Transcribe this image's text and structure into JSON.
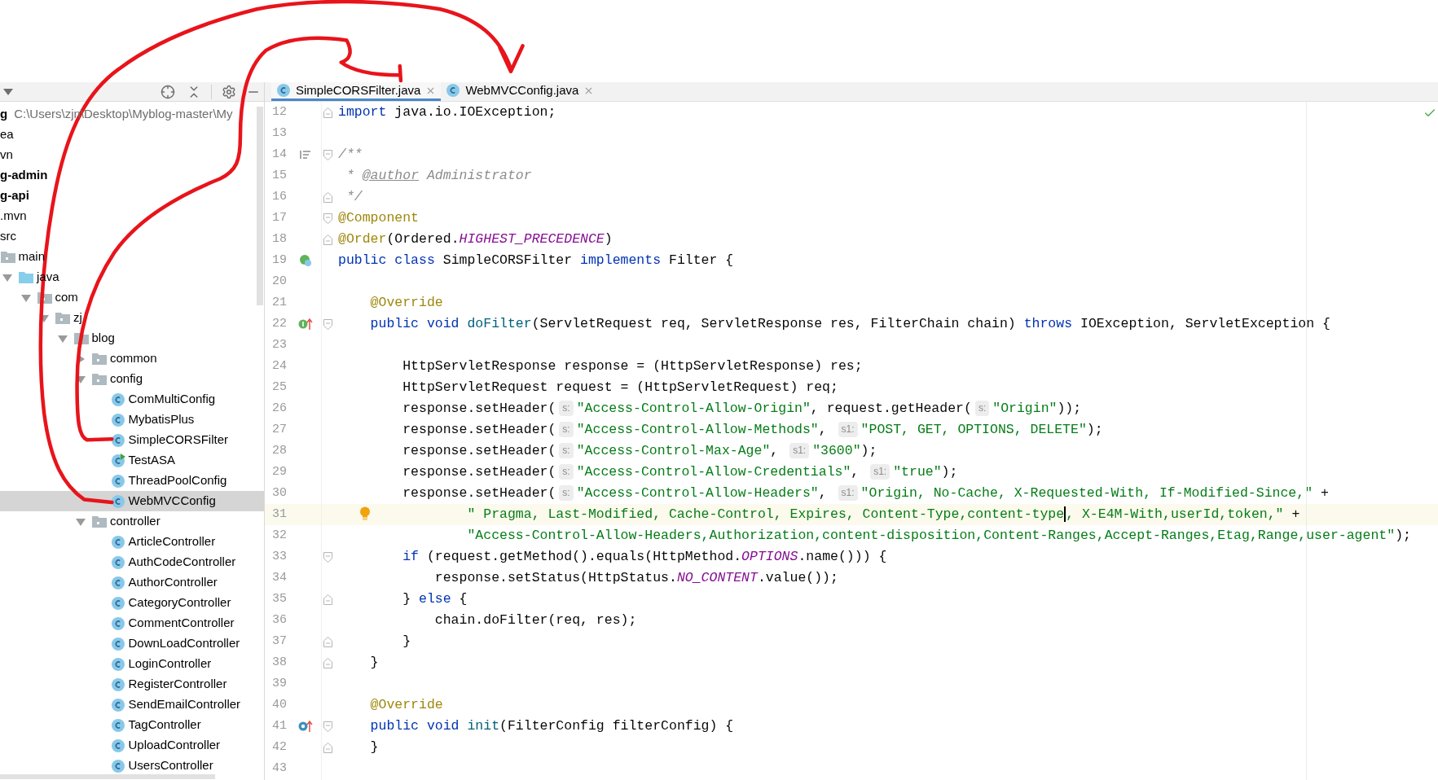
{
  "tree": {
    "items": [
      {
        "kind": "project",
        "name": "g",
        "path": "C:\\Users\\zjn\\Desktop\\Myblog-master\\My",
        "selected": false,
        "children": [
          {
            "name": "ea",
            "selected": false
          },
          {
            "name": "vn",
            "selected": false
          },
          {
            "kind": "module",
            "name": "g-admin",
            "selected": false
          },
          {
            "kind": "module",
            "name": "g-api",
            "selected": false,
            "children": [
              {
                "name": ".mvn",
                "selected": false
              },
              {
                "name": "src",
                "selected": false,
                "children": [
                  {
                    "kind": "folder",
                    "name": "main",
                    "selected": false,
                    "children": [
                      {
                        "kind": "source-root",
                        "name": "java",
                        "expanded": true,
                        "selected": false,
                        "children": [
                          {
                            "kind": "package",
                            "name": "com",
                            "expanded": true,
                            "selected": false,
                            "children": [
                              {
                                "kind": "package",
                                "name": "zj",
                                "expanded": true,
                                "selected": false,
                                "children": [
                                  {
                                    "kind": "package",
                                    "name": "blog",
                                    "expanded": true,
                                    "selected": false,
                                    "children": [
                                      {
                                        "kind": "package",
                                        "name": "common",
                                        "expanded": false,
                                        "selected": false
                                      },
                                      {
                                        "kind": "package",
                                        "name": "config",
                                        "expanded": true,
                                        "selected": false,
                                        "children": [
                                          {
                                            "kind": "class",
                                            "name": "ComMultiConfig",
                                            "runnable": false,
                                            "selected": false
                                          },
                                          {
                                            "kind": "class",
                                            "name": "MybatisPlus",
                                            "runnable": false,
                                            "selected": false
                                          },
                                          {
                                            "kind": "class",
                                            "name": "SimpleCORSFilter",
                                            "runnable": false,
                                            "selected": false
                                          },
                                          {
                                            "kind": "class",
                                            "name": "TestASA",
                                            "runnable": true,
                                            "selected": false
                                          },
                                          {
                                            "kind": "class",
                                            "name": "ThreadPoolConfig",
                                            "runnable": false,
                                            "selected": false
                                          },
                                          {
                                            "kind": "class",
                                            "name": "WebMVCConfig",
                                            "runnable": false,
                                            "selected": true
                                          }
                                        ]
                                      },
                                      {
                                        "kind": "package",
                                        "name": "controller",
                                        "expanded": true,
                                        "selected": false,
                                        "children": [
                                          {
                                            "kind": "class",
                                            "name": "ArticleController",
                                            "runnable": false,
                                            "selected": false
                                          },
                                          {
                                            "kind": "class",
                                            "name": "AuthCodeController",
                                            "runnable": false,
                                            "selected": false
                                          },
                                          {
                                            "kind": "class",
                                            "name": "AuthorController",
                                            "runnable": false,
                                            "selected": false
                                          },
                                          {
                                            "kind": "class",
                                            "name": "CategoryController",
                                            "runnable": false,
                                            "selected": false
                                          },
                                          {
                                            "kind": "class",
                                            "name": "CommentController",
                                            "runnable": false,
                                            "selected": false
                                          },
                                          {
                                            "kind": "class",
                                            "name": "DownLoadController",
                                            "runnable": false,
                                            "selected": false
                                          },
                                          {
                                            "kind": "class",
                                            "name": "LoginController",
                                            "runnable": false,
                                            "selected": false
                                          },
                                          {
                                            "kind": "class",
                                            "name": "RegisterController",
                                            "runnable": false,
                                            "selected": false
                                          },
                                          {
                                            "kind": "class",
                                            "name": "SendEmailController",
                                            "runnable": false,
                                            "selected": false
                                          },
                                          {
                                            "kind": "class",
                                            "name": "TagController",
                                            "runnable": false,
                                            "selected": false
                                          },
                                          {
                                            "kind": "class",
                                            "name": "UploadController",
                                            "runnable": false,
                                            "selected": false
                                          },
                                          {
                                            "kind": "class",
                                            "name": "UsersController",
                                            "runnable": false,
                                            "selected": false
                                          }
                                        ]
                                      }
                                    ]
                                  }
                                ]
                              }
                            ]
                          }
                        ]
                      }
                    ]
                  }
                ]
              }
            ]
          }
        ]
      }
    ]
  },
  "tabs": [
    {
      "label": "SimpleCORSFilter.java",
      "selected": true
    },
    {
      "label": "WebMVCConfig.java",
      "selected": false
    }
  ],
  "editor": {
    "lines": [
      {
        "number": "12",
        "current": false,
        "fold": {
          "kind": "end"
        },
        "tokens": [
          {
            "kind": "kw",
            "text": "import"
          },
          {
            "kind": "plain",
            "text": " java.io.IOException;"
          }
        ]
      },
      {
        "number": "13",
        "current": false
      },
      {
        "number": "14",
        "current": false,
        "gutter": {
          "kind": "doc"
        },
        "fold": {
          "kind": "start"
        },
        "tokens": [
          {
            "kind": "comment",
            "text": "/**"
          }
        ]
      },
      {
        "number": "15",
        "current": false,
        "tokens": [
          {
            "kind": "comment",
            "text": " * "
          },
          {
            "kind": "doctag",
            "text": "@author"
          },
          {
            "kind": "comment",
            "text": " Administrator"
          }
        ]
      },
      {
        "number": "16",
        "current": false,
        "fold": {
          "kind": "end"
        },
        "tokens": [
          {
            "kind": "comment",
            "text": " */"
          }
        ]
      },
      {
        "number": "17",
        "current": false,
        "fold": {
          "kind": "start"
        },
        "tokens": [
          {
            "kind": "ann",
            "text": "@Component"
          }
        ]
      },
      {
        "number": "18",
        "current": false,
        "fold": {
          "kind": "end"
        },
        "tokens": [
          {
            "kind": "ann",
            "text": "@Order"
          },
          {
            "kind": "plain",
            "text": "(Ordered."
          },
          {
            "kind": "const",
            "text": "HIGHEST_PRECEDENCE"
          },
          {
            "kind": "plain",
            "text": ")"
          }
        ]
      },
      {
        "number": "19",
        "current": false,
        "gutter": {
          "kind": "class"
        },
        "tokens": [
          {
            "kind": "kw",
            "text": "public class"
          },
          {
            "kind": "plain",
            "text": " SimpleCORSFilter "
          },
          {
            "kind": "kw",
            "text": "implements"
          },
          {
            "kind": "plain",
            "text": " Filter {"
          }
        ]
      },
      {
        "number": "20",
        "current": false
      },
      {
        "number": "21",
        "current": false,
        "tokens": [
          {
            "kind": "ann",
            "text": "    @Override"
          }
        ]
      },
      {
        "number": "22",
        "current": false,
        "gutter": {
          "kind": "implements"
        },
        "fold": {
          "kind": "start"
        },
        "tokens": [
          {
            "kind": "kw",
            "text": "    public void"
          },
          {
            "kind": "fn",
            "text": " doFilter"
          },
          {
            "kind": "plain",
            "text": "(ServletRequest req, ServletResponse res, FilterChain chain) "
          },
          {
            "kind": "kw",
            "text": "throws"
          },
          {
            "kind": "plain",
            "text": " IOException, ServletException {"
          }
        ]
      },
      {
        "number": "23",
        "current": false
      },
      {
        "number": "24",
        "current": false,
        "tokens": [
          {
            "kind": "plain",
            "text": "        HttpServletResponse response = (HttpServletResponse) res;"
          }
        ]
      },
      {
        "number": "25",
        "current": false,
        "tokens": [
          {
            "kind": "plain",
            "text": "        HttpServletRequest request = (HttpServletRequest) req;"
          }
        ]
      },
      {
        "number": "26",
        "current": false,
        "tokens": [
          {
            "kind": "plain",
            "text": "        response.setHeader("
          },
          {
            "kind": "hint",
            "text": "s:"
          },
          {
            "kind": "str",
            "text": "\"Access-Control-Allow-Origin\""
          },
          {
            "kind": "plain",
            "text": ", request.getHeader("
          },
          {
            "kind": "hint",
            "text": "s:"
          },
          {
            "kind": "str",
            "text": "\"Origin\""
          },
          {
            "kind": "plain",
            "text": "));"
          }
        ]
      },
      {
        "number": "27",
        "current": false,
        "tokens": [
          {
            "kind": "plain",
            "text": "        response.setHeader("
          },
          {
            "kind": "hint",
            "text": "s:"
          },
          {
            "kind": "str",
            "text": "\"Access-Control-Allow-Methods\""
          },
          {
            "kind": "plain",
            "text": ", "
          },
          {
            "kind": "hint",
            "text": "s1:"
          },
          {
            "kind": "str",
            "text": "\"POST, GET, OPTIONS, DELETE\""
          },
          {
            "kind": "plain",
            "text": ");"
          }
        ]
      },
      {
        "number": "28",
        "current": false,
        "tokens": [
          {
            "kind": "plain",
            "text": "        response.setHeader("
          },
          {
            "kind": "hint",
            "text": "s:"
          },
          {
            "kind": "str",
            "text": "\"Access-Control-Max-Age\""
          },
          {
            "kind": "plain",
            "text": ", "
          },
          {
            "kind": "hint",
            "text": "s1:"
          },
          {
            "kind": "str",
            "text": "\"3600\""
          },
          {
            "kind": "plain",
            "text": ");"
          }
        ]
      },
      {
        "number": "29",
        "current": false,
        "tokens": [
          {
            "kind": "plain",
            "text": "        response.setHeader("
          },
          {
            "kind": "hint",
            "text": "s:"
          },
          {
            "kind": "str",
            "text": "\"Access-Control-Allow-Credentials\""
          },
          {
            "kind": "plain",
            "text": ", "
          },
          {
            "kind": "hint",
            "text": "s1:"
          },
          {
            "kind": "str",
            "text": "\"true\""
          },
          {
            "kind": "plain",
            "text": ");"
          }
        ]
      },
      {
        "number": "30",
        "current": false,
        "tokens": [
          {
            "kind": "plain",
            "text": "        response.setHeader("
          },
          {
            "kind": "hint",
            "text": "s:"
          },
          {
            "kind": "str",
            "text": "\"Access-Control-Allow-Headers\""
          },
          {
            "kind": "plain",
            "text": ", "
          },
          {
            "kind": "hint",
            "text": "s1:"
          },
          {
            "kind": "str",
            "text": "\"Origin, No-Cache, X-Requested-With, If-Modified-Since,\""
          },
          {
            "kind": "plain",
            "text": " +"
          }
        ]
      },
      {
        "number": "31",
        "current": true,
        "bulb": true,
        "tokens": [
          {
            "kind": "str",
            "text": "                \" Pragma, Last-Modified, Cache-Control, Expires, Content-Type,content-type"
          },
          {
            "kind": "caret"
          },
          {
            "kind": "str",
            "text": ", X-E4M-With,userId,token,\""
          },
          {
            "kind": "plain",
            "text": " +"
          }
        ]
      },
      {
        "number": "32",
        "current": false,
        "tokens": [
          {
            "kind": "str",
            "text": "                \"Access-Control-Allow-Headers,Authorization,content-disposition,Content-Ranges,Accept-Ranges,Etag,Range,user-agent\""
          },
          {
            "kind": "plain",
            "text": ");"
          }
        ]
      },
      {
        "number": "33",
        "current": false,
        "fold": {
          "kind": "start"
        },
        "tokens": [
          {
            "kind": "kw",
            "text": "        if"
          },
          {
            "kind": "plain",
            "text": " (request.getMethod().equals(HttpMethod."
          },
          {
            "kind": "const",
            "text": "OPTIONS"
          },
          {
            "kind": "plain",
            "text": ".name())) {"
          }
        ]
      },
      {
        "number": "34",
        "current": false,
        "tokens": [
          {
            "kind": "plain",
            "text": "            response.setStatus(HttpStatus."
          },
          {
            "kind": "const",
            "text": "NO_CONTENT"
          },
          {
            "kind": "plain",
            "text": ".value());"
          }
        ]
      },
      {
        "number": "35",
        "current": false,
        "fold": {
          "kind": "end"
        },
        "tokens": [
          {
            "kind": "plain",
            "text": "        } "
          },
          {
            "kind": "kw",
            "text": "else"
          },
          {
            "kind": "plain",
            "text": " {"
          }
        ]
      },
      {
        "number": "36",
        "current": false,
        "tokens": [
          {
            "kind": "plain",
            "text": "            chain.doFilter(req, res);"
          }
        ]
      },
      {
        "number": "37",
        "current": false,
        "fold": {
          "kind": "end"
        },
        "tokens": [
          {
            "kind": "plain",
            "text": "        }"
          }
        ]
      },
      {
        "number": "38",
        "current": false,
        "fold": {
          "kind": "end"
        },
        "tokens": [
          {
            "kind": "plain",
            "text": "    }"
          }
        ]
      },
      {
        "number": "39",
        "current": false
      },
      {
        "number": "40",
        "current": false,
        "tokens": [
          {
            "kind": "ann",
            "text": "    @Override"
          }
        ]
      },
      {
        "number": "41",
        "current": false,
        "gutter": {
          "kind": "override"
        },
        "fold": {
          "kind": "start"
        },
        "tokens": [
          {
            "kind": "kw",
            "text": "    public void"
          },
          {
            "kind": "fn",
            "text": " init"
          },
          {
            "kind": "plain",
            "text": "(FilterConfig filterConfig) {"
          }
        ]
      },
      {
        "number": "42",
        "current": false,
        "fold": {
          "kind": "end"
        },
        "tokens": [
          {
            "kind": "plain",
            "text": "    }"
          }
        ]
      },
      {
        "number": "43",
        "current": false
      }
    ]
  }
}
